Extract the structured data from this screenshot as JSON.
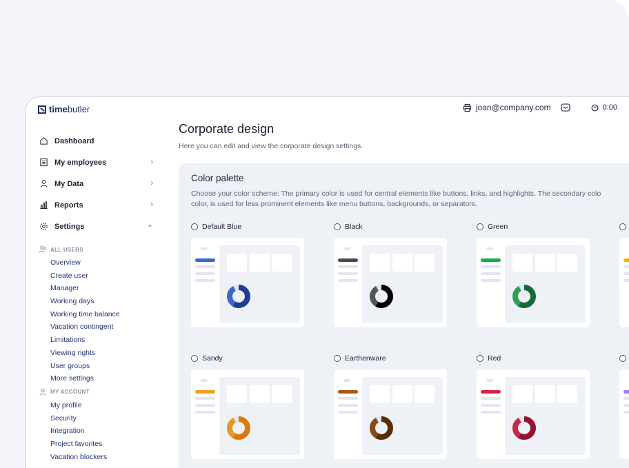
{
  "app": {
    "logo_bold": "time",
    "logo_rest": "butler"
  },
  "topbar": {
    "email": "joan@company.com",
    "timer": "0:00"
  },
  "sidebar": {
    "items": [
      {
        "label": "Dashboard",
        "icon": "home-icon",
        "chevron": ""
      },
      {
        "label": "My employees",
        "icon": "employees-icon",
        "chevron": "›"
      },
      {
        "label": "My Data",
        "icon": "person-icon",
        "chevron": "›"
      },
      {
        "label": "Reports",
        "icon": "chart-icon",
        "chevron": "›"
      },
      {
        "label": "Settings",
        "icon": "gear-icon",
        "chevron": "⌄"
      }
    ],
    "all_users_heading": "ALL USERS",
    "all_users": [
      "Overview",
      "Create user",
      "Manager",
      "Working days",
      "Working time balance",
      "Vacation contingent",
      "Limitations",
      "Viewing rights",
      "User groups",
      "More settings"
    ],
    "my_account_heading": "MY ACCOUNT",
    "my_account": [
      "My profile",
      "Security",
      "Integration",
      "Project favorites",
      "Vacation blockers"
    ]
  },
  "main": {
    "title": "Corporate design",
    "description": "Here you can edit and view the corporate design settings."
  },
  "palette": {
    "title": "Color palette",
    "description_line1": "Choose your color scheme: The primary color is used for central elements like buttons, links, and highlights. The secondary colo",
    "description_line2": "color, is used for less prominent elements like menu buttons, backgrounds, or separators.",
    "options": [
      {
        "name": "Default Blue",
        "primary": "#3a67c9",
        "dark": "#1e3f8f",
        "bar": "#3a67c9"
      },
      {
        "name": "Black",
        "primary": "#555555",
        "dark": "#000000",
        "bar": "#4a4a4a"
      },
      {
        "name": "Green",
        "primary": "#2e9e55",
        "dark": "#146b36",
        "bar": "#1da84f"
      },
      {
        "name": "",
        "primary": "#f0b400",
        "dark": "#c99000",
        "bar": "#f0b400"
      },
      {
        "name": "Sandy",
        "primary": "#e09a22",
        "dark": "#d97b0a",
        "bar": "#f0a020"
      },
      {
        "name": "Earthenware",
        "primary": "#8a4a10",
        "dark": "#5a2c05",
        "bar": "#a85a10"
      },
      {
        "name": "Red",
        "primary": "#c8284a",
        "dark": "#9a1030",
        "bar": "#d4224a"
      },
      {
        "name": "",
        "primary": "#9a70e0",
        "dark": "#7048c0",
        "bar": "#a080f0"
      }
    ]
  }
}
